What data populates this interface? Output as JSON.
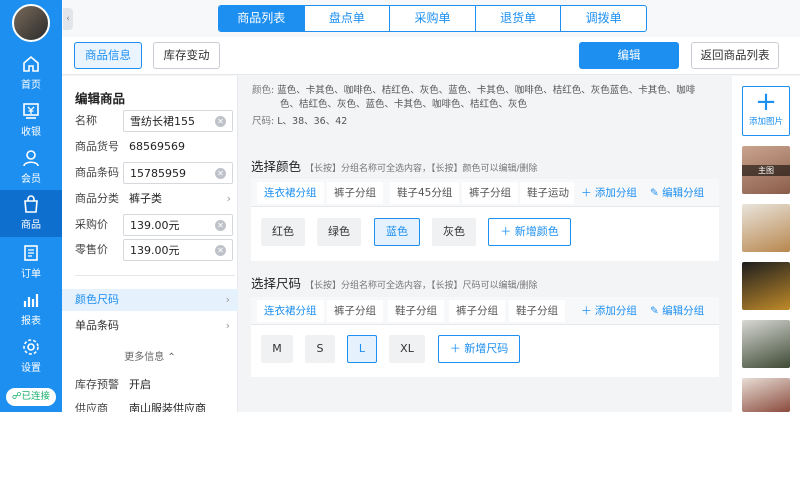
{
  "nav": {
    "items": [
      {
        "label": "首页",
        "icon": "home-icon"
      },
      {
        "label": "收银",
        "icon": "cashier-icon"
      },
      {
        "label": "会员",
        "icon": "member-icon"
      },
      {
        "label": "商品",
        "icon": "goods-bag-icon"
      },
      {
        "label": "订单",
        "icon": "order-icon"
      },
      {
        "label": "报表",
        "icon": "report-icon"
      },
      {
        "label": "设置",
        "icon": "gear-icon"
      }
    ],
    "status": "已连接"
  },
  "tabs": [
    "商品列表",
    "盘点单",
    "采购单",
    "退货单",
    "调拨单"
  ],
  "actionbar": {
    "tab_info": "商品信息",
    "tab_stock": "库存变动",
    "edit": "编辑",
    "back": "返回商品列表"
  },
  "left": {
    "title": "编辑商品",
    "fields": {
      "name_label": "名称",
      "name_value": "雪纺长裙155",
      "sku_label": "商品货号",
      "sku_value": "68569569",
      "barcode_label": "商品条码",
      "barcode_value": "15785959",
      "category_label": "商品分类",
      "category_value": "裤子类",
      "purchase_label": "采购价",
      "purchase_value": "139.00元",
      "retail_label": "零售价",
      "retail_value": "139.00元"
    },
    "links": {
      "color_size": "颜色尺码",
      "item_barcode": "单品条码"
    },
    "more": "更多信息",
    "stock_alert_label": "库存预警",
    "stock_alert_value": "开启",
    "supplier_label": "供应商",
    "supplier_value": "南山服装供应商"
  },
  "summary": {
    "color_key": "颜色:",
    "color_line1": "蓝色、卡其色、咖啡色、桔红色、灰色、蓝色、卡其色、咖啡色、桔红色、灰色蓝色、卡其色、咖啡",
    "color_line2": "色、桔红色、灰色、蓝色、卡其色、咖啡色、桔红色、灰色",
    "size_key": "尺码:",
    "size_value": "L、38、36、42"
  },
  "color_section": {
    "title": "选择颜色",
    "hint": "【长按】分组名称可全选内容，【长按】颜色可以编辑/删除",
    "groups": [
      "连衣裙分组",
      "裤子分组",
      "鞋子45分组",
      "裤子分组",
      "鞋子运动"
    ],
    "add_group": "添加分组",
    "edit_group": "编辑分组",
    "options": [
      "红色",
      "绿色",
      "蓝色",
      "灰色"
    ],
    "selected": "蓝色",
    "add_option": "新增颜色"
  },
  "size_section": {
    "title": "选择尺码",
    "hint": "【长按】分组名称可全选内容，【长按】尺码可以编辑/删除",
    "groups": [
      "连衣裙分组",
      "裤子分组",
      "鞋子分组",
      "裤子分组",
      "鞋子分组"
    ],
    "add_group": "添加分组",
    "edit_group": "编辑分组",
    "options": [
      "M",
      "S",
      "L",
      "XL"
    ],
    "selected": "L",
    "add_option": "新增尺码"
  },
  "images": {
    "add_label": "添加图片",
    "main_label": "主图"
  },
  "colors": {
    "accent": "#1c8ff0",
    "nav_bg": "#1c8ff0",
    "connected": "#17b26a"
  }
}
